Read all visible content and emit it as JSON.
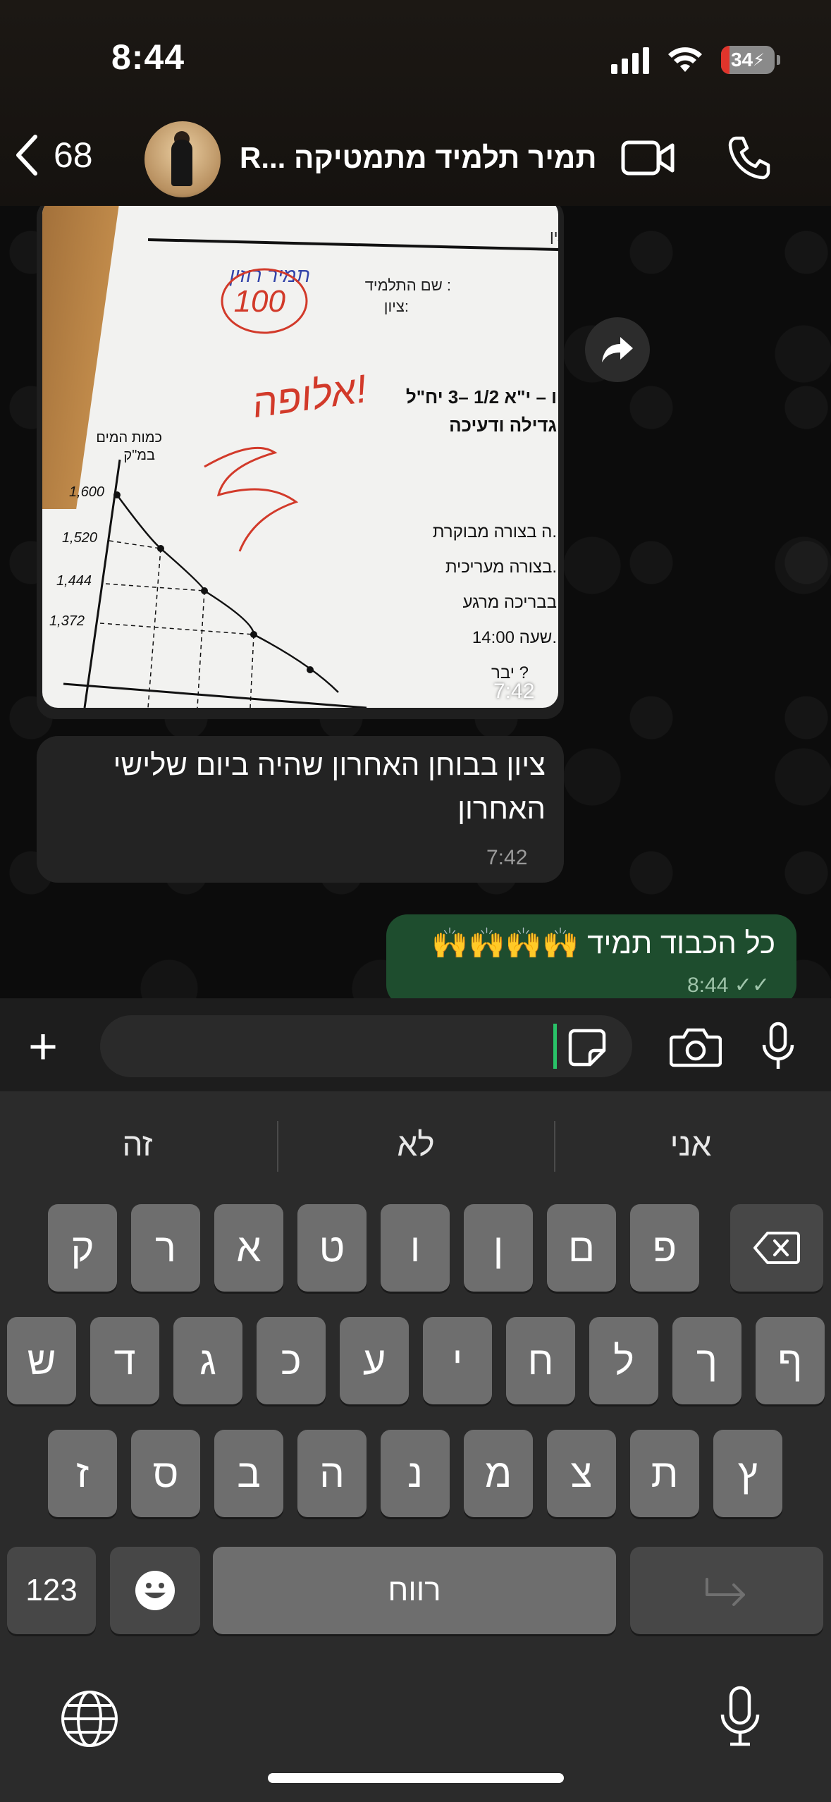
{
  "status_bar": {
    "time": "8:44",
    "battery": "34"
  },
  "header": {
    "back_count": "68",
    "contact_name": "תמיר תלמיד מתמטיקה ...R"
  },
  "messages": {
    "image_time": "7:42",
    "incoming_text": "ציון בבוחן האחרון שהיה ביום שלישי האחרון",
    "incoming_time": "7:42",
    "outgoing_text": "כל הכבוד תמיד 🙌🙌🙌🙌",
    "outgoing_time": "8:44"
  },
  "photo": {
    "header_line": "עים ולאומניות - מודיעין",
    "student_label": "שם התלמיד :",
    "student_name": "תמיר רוזין",
    "grade_label": "ציון:",
    "grade": "100",
    "praise": "אלופה!",
    "course_line": "ו – י\"א 1/2 –3 יח\"ל",
    "topic": "גדילה ודעיכה",
    "y_axis_label": "כמות המים",
    "y_axis_unit": "במ\"ק",
    "y_ticks": [
      "1,600",
      "1,520",
      "1,444",
      "1,372"
    ],
    "line1": "ה בצורה מבוקרת.",
    "line2": "בצורה מעריכית.",
    "line3": "בבריכה מרגע",
    "line4": "שעה 14:00.",
    "line5": "יבר ?"
  },
  "keyboard": {
    "suggestions": [
      "זה",
      "לא",
      "אני"
    ],
    "row1": [
      "ק",
      "ר",
      "א",
      "ט",
      "ו",
      "ן",
      "ם",
      "פ"
    ],
    "row2": [
      "ש",
      "ד",
      "ג",
      "כ",
      "ע",
      "י",
      "ח",
      "ל",
      "ך",
      "ף"
    ],
    "row3": [
      "ז",
      "ס",
      "ב",
      "ה",
      "נ",
      "מ",
      "צ",
      "ת",
      "ץ"
    ],
    "numbers_label": "123",
    "space_label": "רווח"
  }
}
